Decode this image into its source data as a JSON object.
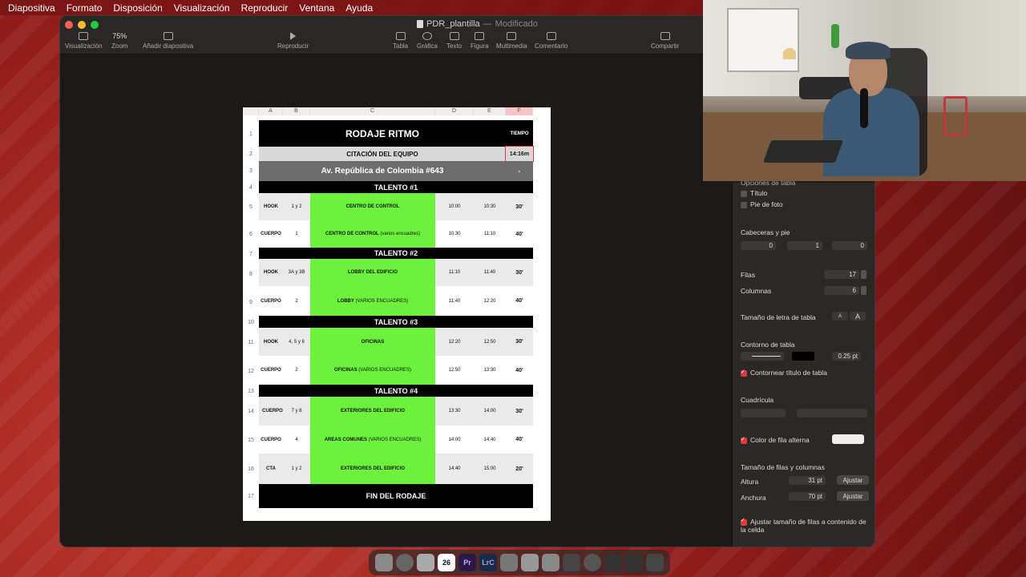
{
  "menubar": {
    "items": [
      "Diapositiva",
      "Formato",
      "Disposición",
      "Visualización",
      "Reproducir",
      "Ventana",
      "Ayuda"
    ]
  },
  "window": {
    "title": "PDR_plantilla",
    "title_sep": "—",
    "status": "Modificado"
  },
  "toolbar": {
    "view_label": "Visualización",
    "zoom_value": "75%",
    "zoom_label": "Zoom",
    "add_slide_label": "Añadir diapositiva",
    "play_label": "Reproducir",
    "table_label": "Tabla",
    "chart_label": "Gráfica",
    "text_label": "Texto",
    "shape_label": "Figura",
    "media_label": "Multimedia",
    "comment_label": "Comentario",
    "share_label": "Compartir"
  },
  "table": {
    "col_headers": [
      "A",
      "B",
      "C",
      "D",
      "E",
      "F"
    ],
    "row_numbers": [
      "1",
      "2",
      "3",
      "4",
      "5",
      "6",
      "7",
      "8",
      "9",
      "10",
      "11",
      "12",
      "13",
      "14",
      "15",
      "16",
      "17"
    ],
    "title": "RODAJE RITMO",
    "tiempo_header": "TIEMPO",
    "citacion": "CITACIÓN DEL EQUIPO",
    "citacion_time": "14:16m",
    "address": "Av. República de Colombia #643",
    "address_time": "-",
    "footer": "FIN DEL RODAJE",
    "talento1": "TALENTO #1",
    "talento2": "TALENTO #2",
    "talento3": "TALENTO #3",
    "talento4": "TALENTO #4",
    "r5": {
      "type": "HOOK",
      "num": "1 y 2",
      "loc": "CENTRO DE CONTROL",
      "start": "10:00",
      "end": "10:30",
      "dur": "30'"
    },
    "r6": {
      "type": "CUERPO",
      "num": "1",
      "loc": "CENTRO DE CONTROL",
      "loc_extra": "(varios encuadres)",
      "start": "10:30",
      "end": "11:10",
      "dur": "40'"
    },
    "r8": {
      "type": "HOOK",
      "num": "3A y 3B",
      "loc": "LOBBY DEL EDIFICIO",
      "start": "11:10",
      "end": "11:40",
      "dur": "30'"
    },
    "r9": {
      "type": "CUERPO",
      "num": "2",
      "loc": "LOBBY",
      "loc_extra": "(VARIOS ENCUADRES)",
      "start": "11:40",
      "end": "12:20",
      "dur": "40'"
    },
    "r11": {
      "type": "HOOK",
      "num": "4, 5 y 6",
      "loc": "OFICINAS",
      "start": "12:20",
      "end": "12:50",
      "dur": "30'"
    },
    "r12": {
      "type": "CUERPO",
      "num": "2",
      "loc": "OFICINAS",
      "loc_extra": "(VARIOS ENCUADRES)",
      "start": "12:50",
      "end": "13:30",
      "dur": "40'"
    },
    "r14": {
      "type": "CUERPO",
      "num": "7 y 8",
      "loc": "EXTERIORES DEL EDIFICIO",
      "start": "13:30",
      "end": "14:00",
      "dur": "30'"
    },
    "r15": {
      "type": "CUERPO",
      "num": "4",
      "loc": "AREAS COMUNES",
      "loc_extra": "(VARIOS ENCUADRES)",
      "start": "14:00",
      "end": "14:40",
      "dur": "40'"
    },
    "r16": {
      "type": "CTA",
      "num": "1 y 2",
      "loc": "EXTERIORES DEL EDIFICIO",
      "start": "14:40",
      "end": "15:00",
      "dur": "20'"
    }
  },
  "inspector": {
    "options_header": "Opciones de tabla",
    "titulo": "Título",
    "pie": "Pie de foto",
    "headers_footer": "Cabeceras y pie",
    "header_rows": "0",
    "header_cols": "1",
    "footer_rows": "0",
    "filas_label": "Filas",
    "filas_value": "17",
    "columnas_label": "Columnas",
    "columnas_value": "6",
    "font_size_label": "Tamaño de letra de tabla",
    "font_small": "A",
    "font_large": "A",
    "outline_label": "Contorno de tabla",
    "outline_width": "0.25 pt",
    "outline_title": "Contornear título de tabla",
    "grid_label": "Cuadrícula",
    "alt_row": "Color de fila alterna",
    "size_label": "Tamaño de filas y columnas",
    "altura_label": "Altura",
    "altura_value": "31 pt",
    "anchura_label": "Anchura",
    "anchura_value": "70 pt",
    "ajustar": "Ajustar",
    "auto_fit": "Ajustar tamaño de filas a contenido de la celda"
  },
  "dock": {
    "calendar_day": "26",
    "pr": "Pr",
    "lrc": "LrC"
  },
  "colors": {
    "accent": "#e03b3b",
    "green_cell": "#6cf23c",
    "header_black": "#000000"
  }
}
